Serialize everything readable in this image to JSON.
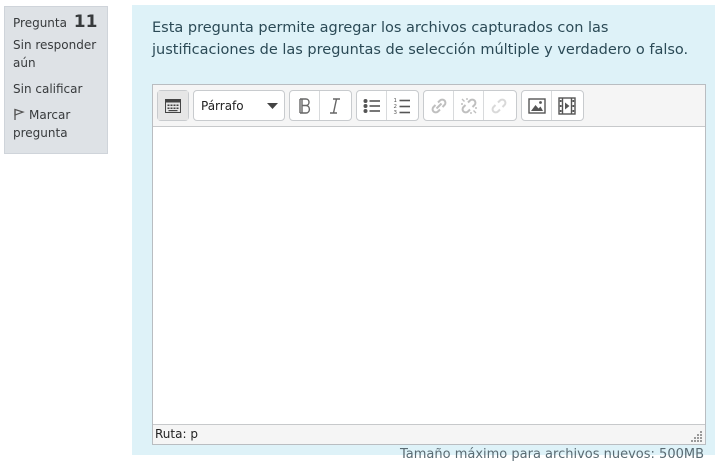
{
  "info": {
    "question_label": "Pregunta",
    "question_number": "11",
    "state": "Sin responder aún",
    "grade": "Sin calificar",
    "flag_label": "Marcar pregunta"
  },
  "question": {
    "text": "Esta pregunta permite agregar los archivos capturados con las justificaciones de las preguntas de selección múltiple y verdadero o falso."
  },
  "editor": {
    "format_select": "Párrafo",
    "toolbar_icons": [
      "toolbar-toggle-icon",
      "bold-icon",
      "italic-icon",
      "unordered-list-icon",
      "ordered-list-icon",
      "link-icon",
      "unlink-icon",
      "emoticon-icon",
      "image-icon",
      "media-icon"
    ],
    "path_label": "Ruta: p"
  },
  "footer": {
    "max_size_text": "Tamaño máximo para archivos nuevos: 500MB"
  },
  "colors": {
    "content_bg": "#def2f8",
    "info_bg": "#dee2e6"
  }
}
